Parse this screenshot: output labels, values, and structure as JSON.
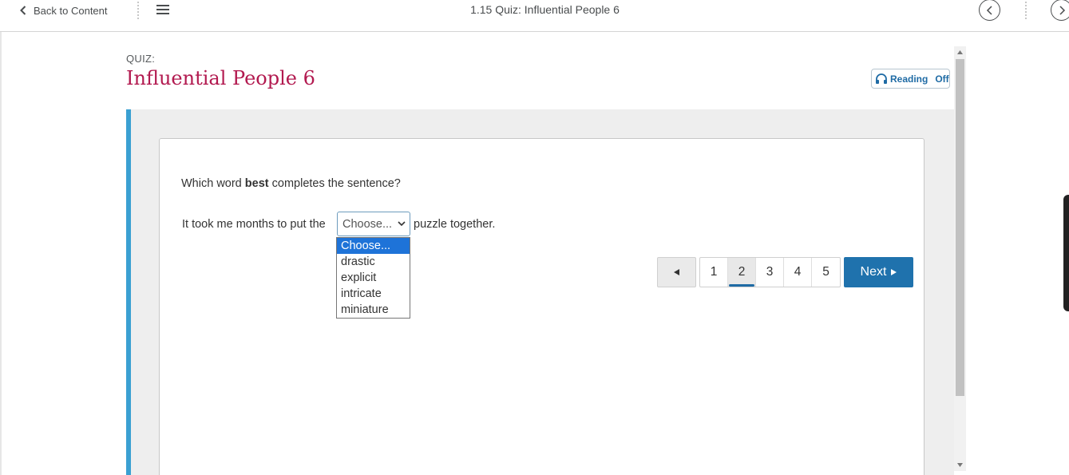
{
  "topbar": {
    "back_label": "Back to Content",
    "page_heading": "1.15 Quiz: Influential People 6"
  },
  "quiz": {
    "label": "QUIZ:",
    "title": "Influential People 6"
  },
  "reading": {
    "label": "Reading",
    "state": "Off"
  },
  "question": {
    "prefix": "Which word ",
    "emphasis": "best",
    "suffix": " completes the sentence?",
    "sentence_before": "It took me months to put the",
    "sentence_after": "puzzle together.",
    "select_value": "Choose...",
    "options": [
      {
        "label": "Choose...",
        "selected": true
      },
      {
        "label": "drastic",
        "selected": false
      },
      {
        "label": "explicit",
        "selected": false
      },
      {
        "label": "intricate",
        "selected": false
      },
      {
        "label": "miniature",
        "selected": false
      }
    ]
  },
  "pagination": {
    "pages": [
      "1",
      "2",
      "3",
      "4",
      "5"
    ],
    "current_page": "2",
    "next_label": "Next"
  },
  "colors": {
    "title": "#b2194f",
    "accent": "#3aa0d2",
    "primary_button": "#1f72ad",
    "selected_option": "#1e73d8"
  }
}
